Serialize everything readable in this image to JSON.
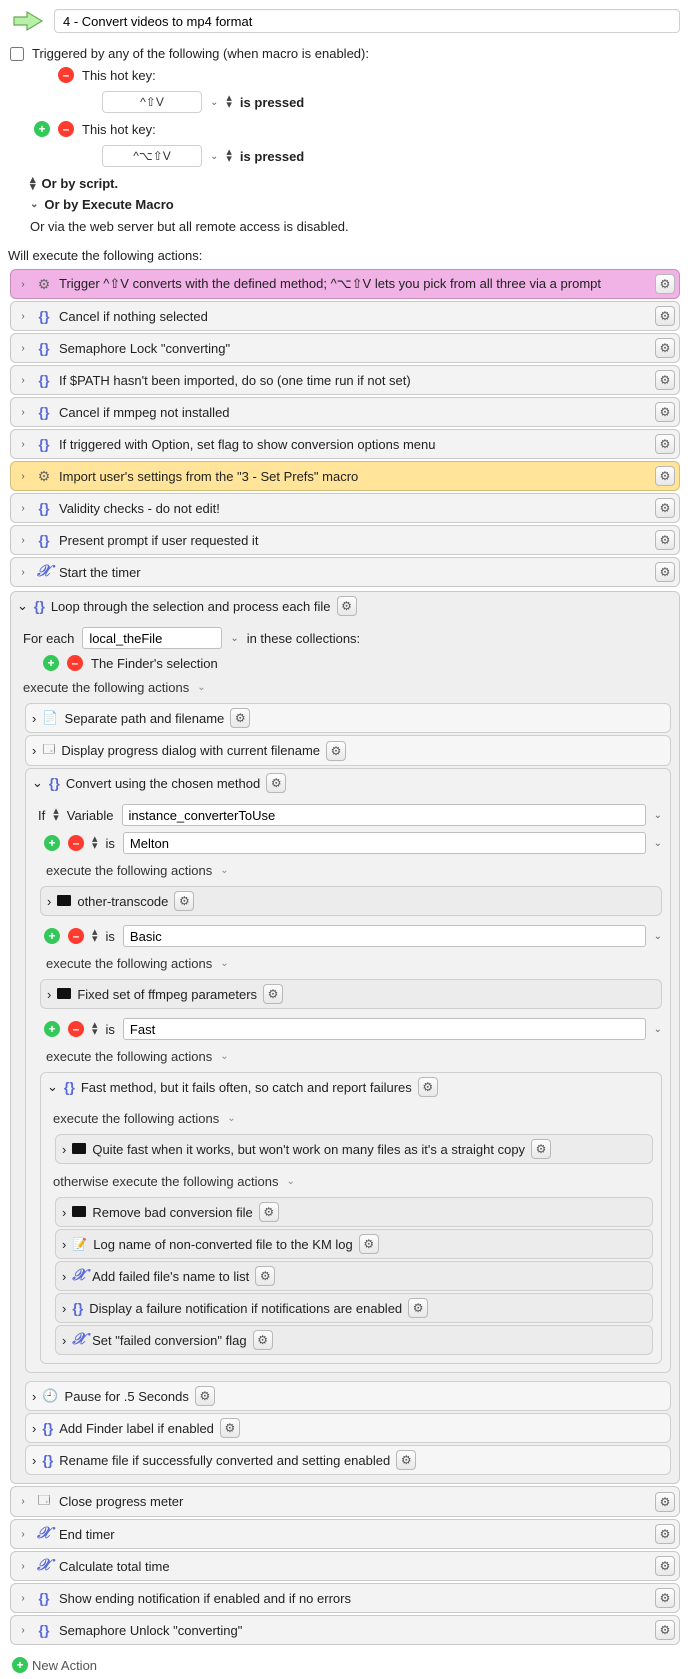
{
  "header": {
    "title": "4 - Convert videos to mp4 format"
  },
  "triggered_label": "Triggered by any of the following (when macro is enabled):",
  "trigger1_label": "This hot key:",
  "trigger1_key": "^⇧V",
  "trigger1_mode": "is pressed",
  "trigger2_label": "This hot key:",
  "trigger2_key": "^⌥⇧V",
  "trigger2_mode": "is pressed",
  "or_script": "Or by script.",
  "or_exec_macro": "Or by Execute Macro",
  "or_web": "Or via the web server but all remote access is disabled.",
  "will_execute": "Will execute the following actions:",
  "actions": {
    "a1": "Trigger ^⇧V converts with the defined method; ^⌥⇧V lets you pick from all three via a prompt",
    "a2": "Cancel if nothing selected",
    "a3": "Semaphore Lock \"converting\"",
    "a4": "If $PATH hasn't been imported, do so (one time run if not set)",
    "a5": "Cancel if mmpeg not installed",
    "a6": "If triggered with Option, set flag to show conversion options menu",
    "a7": "Import user's settings from the \"3 - Set Prefs\" macro",
    "a8": "Validity checks - do not edit!",
    "a9": "Present prompt if user requested it",
    "a10": "Start the timer",
    "loop_title": "Loop through the selection and process each file",
    "for_each": "For each",
    "loop_var": "local_theFile",
    "in_collections": "in these collections:",
    "finder_sel": "The Finder's selection",
    "exec_following": "execute the following actions",
    "l1": "Separate path and filename",
    "l2": "Display progress dialog with current filename",
    "convert_title": "Convert using the chosen method",
    "if_label": "If",
    "variable_label": "Variable",
    "convert_var": "instance_converterToUse",
    "is_label": "is",
    "m1": "Melton",
    "m1_action": "other-transcode",
    "m2": "Basic",
    "m2_action": "Fixed set of ffmpeg parameters",
    "m3": "Fast",
    "fast_title": "Fast method, but it fails often, so catch and report failures",
    "fast_try": "Quite fast when it works, but won't work on many files as it's a straight copy",
    "otherwise_exec": "otherwise execute the following actions",
    "f1": "Remove bad conversion file",
    "f2": "Log name of non-converted file to the KM log",
    "f3": "Add failed file's name to list",
    "f4": "Display a failure notification if notifications are enabled",
    "f5": "Set \"failed conversion\" flag",
    "p1": "Pause for .5 Seconds",
    "p2": "Add Finder label if enabled",
    "p3": "Rename file if successfully converted and setting enabled",
    "e1": "Close progress meter",
    "e2": "End timer",
    "e3": "Calculate total time",
    "e4": "Show ending notification if enabled and if no errors",
    "e5": "Semaphore Unlock \"converting\""
  },
  "footer": {
    "new_action": "New Action"
  }
}
